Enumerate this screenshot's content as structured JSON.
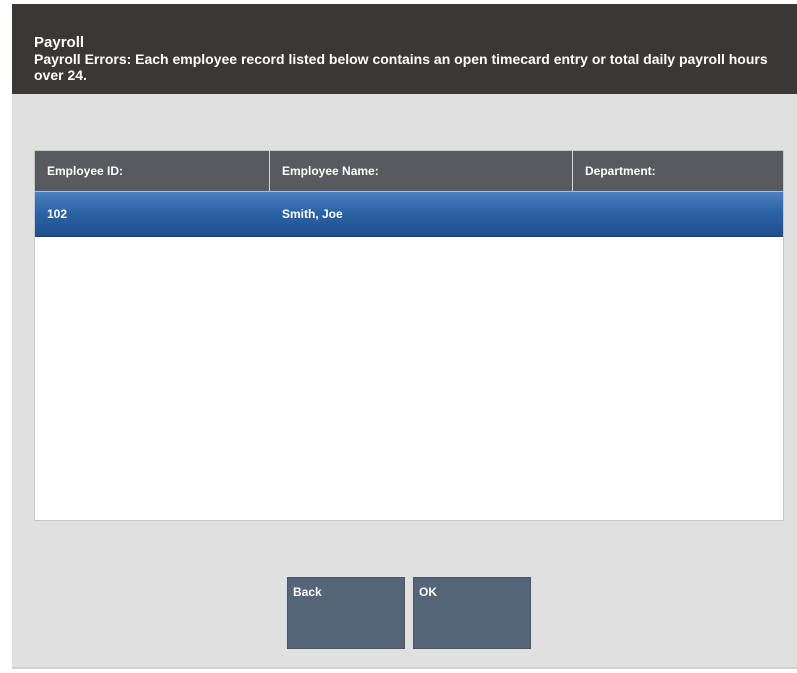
{
  "header": {
    "title": "Payroll",
    "message": "Payroll Errors: Each employee record listed below contains an open timecard entry or total daily payroll hours over 24."
  },
  "table": {
    "columns": [
      "Employee ID:",
      "Employee Name:",
      "Department:"
    ],
    "rows": [
      {
        "employee_id": "102",
        "employee_name": "Smith, Joe",
        "department": "",
        "selected": true
      }
    ]
  },
  "buttons": {
    "back": "Back",
    "ok": "OK"
  },
  "colors": {
    "header_bg": "#393834",
    "table_header_bg": "#575a5e",
    "selected_row": "#2c64a8",
    "button_bg": "#566478",
    "window_bg": "#e0e0e0"
  }
}
